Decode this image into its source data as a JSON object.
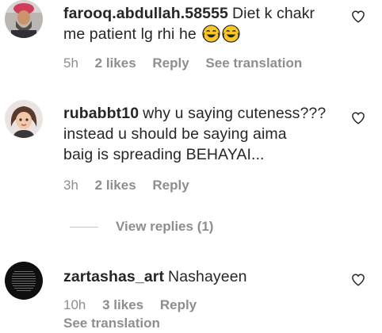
{
  "comments": [
    {
      "username": "farooq.abdullah.58555",
      "text_line1": "Diet k chakr",
      "text_line2": "me patient lg rhi he",
      "emojis": [
        "face-with-tears-of-joy",
        "face-with-tears-of-joy"
      ],
      "time": "5h",
      "likes": "2 likes",
      "reply": "Reply",
      "see_translation": "See translation"
    },
    {
      "username": "rubabbt10",
      "text_line1": "why u saying cuteness???",
      "text_line2": "instead u should be saying aima",
      "text_line3": "baig is spreading BEHAYAI...",
      "time": "3h",
      "likes": "2 likes",
      "reply": "Reply",
      "view_replies": "View replies (1)"
    },
    {
      "username": "zartashas_art",
      "text_line1": "Nashayeen",
      "time": "10h",
      "likes": "3 likes",
      "reply": "Reply",
      "see_translation": "See translation"
    }
  ],
  "icons": {
    "like": "heart-outline-icon",
    "emoji": "face-with-tears-of-joy"
  },
  "colors": {
    "text": "#262626",
    "secondary": "#8e8e8e",
    "emoji_face": "#f9c623"
  }
}
